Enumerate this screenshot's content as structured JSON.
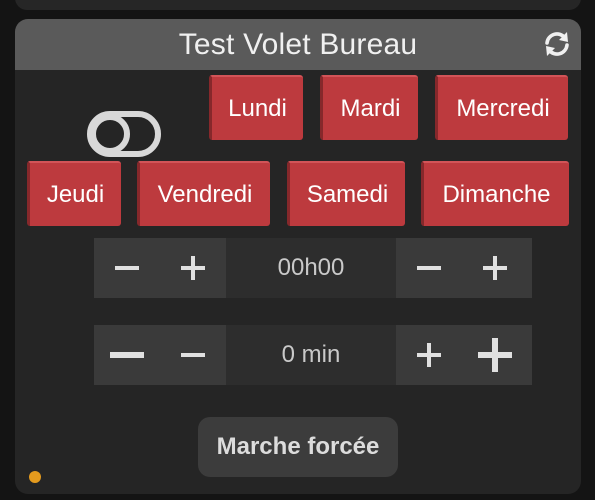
{
  "card": {
    "title": "Test Volet Bureau"
  },
  "days": {
    "lundi": "Lundi",
    "mardi": "Mardi",
    "mercredi": "Mercredi",
    "jeudi": "Jeudi",
    "vendredi": "Vendredi",
    "samedi": "Samedi",
    "dimanche": "Dimanche"
  },
  "time_control": {
    "value": "00h00"
  },
  "offset_control": {
    "value": "0 min"
  },
  "force_button": {
    "label": "Marche forcée"
  },
  "colors": {
    "day_active": "#bd3a3e",
    "header": "#5a5a5a",
    "status_dot": "#e39a1e"
  },
  "icons": {
    "refresh": "refresh-icon",
    "toggle": "toggle-icon",
    "minus": "minus-icon",
    "plus": "plus-icon"
  }
}
